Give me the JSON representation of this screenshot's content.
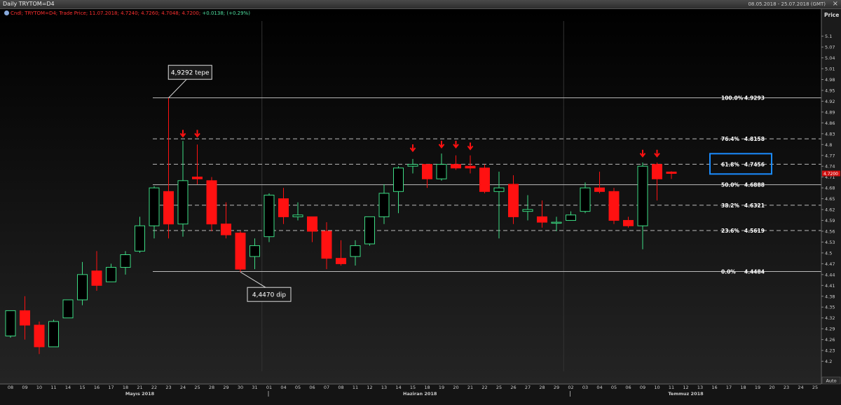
{
  "window": {
    "title": "Daily TRYTOM=D4",
    "date_range": "08.05.2018 - 25.07.2018 (GMT)",
    "close_glyph": "×"
  },
  "legend": {
    "icon": "series-dot-icon",
    "series_text": "Cndl; TRYTOM=D4; Trade Price; 11.07.2018; 4.7240; 4.7260; 4.7048; 4.7200;",
    "change_text": "+0.0138; (+0.29%)"
  },
  "colors": {
    "up": "#3ddc84",
    "down": "#ff1111",
    "arrow": "#ff1111",
    "grid": "#bbbbbb",
    "highlight_box": "#1a8cff",
    "current_price_bg": "#d01010"
  },
  "chart_data": {
    "type": "candlestick",
    "ylabel": "Price",
    "ylim": [
      4.172,
      5.142
    ],
    "y_ticks": [
      "5.1",
      "5.07",
      "5.04",
      "5.01",
      "4.98",
      "4.95",
      "4.92",
      "4.89",
      "4.86",
      "4.83",
      "4.8",
      "4.77",
      "4.74",
      "4.71",
      "4.68",
      "4.65",
      "4.62",
      "4.59",
      "4.56",
      "4.53",
      "4.5",
      "4.47",
      "4.44",
      "4.41",
      "4.38",
      "4.35",
      "4.32",
      "4.29",
      "4.26",
      "4.23",
      "4.2"
    ],
    "current_price_label": "4.7200",
    "x_ticks": [
      "08",
      "09",
      "10",
      "11",
      "14",
      "15",
      "16",
      "17",
      "18",
      "21",
      "22",
      "23",
      "24",
      "25",
      "28",
      "29",
      "30",
      "31",
      "01",
      "04",
      "05",
      "06",
      "07",
      "08",
      "11",
      "12",
      "13",
      "14",
      "15",
      "18",
      "19",
      "20",
      "21",
      "22",
      "25",
      "26",
      "27",
      "28",
      "29",
      "02",
      "03",
      "04",
      "05",
      "06",
      "09",
      "10",
      "11",
      "12",
      "13",
      "16",
      "17",
      "18",
      "19",
      "20",
      "23",
      "24",
      "25"
    ],
    "month_labels": [
      {
        "label": "Mayıs 2018",
        "at": 9
      },
      {
        "label": "Haziran 2018",
        "at": 28.5
      },
      {
        "label": "Temmuz 2018",
        "at": 47
      }
    ],
    "month_separators": [
      18,
      39
    ],
    "auto_label": "Auto",
    "candles": [
      {
        "d": "08",
        "o": 4.27,
        "h": 4.34,
        "l": 4.265,
        "c": 4.34
      },
      {
        "d": "09",
        "o": 4.34,
        "h": 4.38,
        "l": 4.26,
        "c": 4.3
      },
      {
        "d": "10",
        "o": 4.3,
        "h": 4.31,
        "l": 4.22,
        "c": 4.24
      },
      {
        "d": "11",
        "o": 4.24,
        "h": 4.315,
        "l": 4.24,
        "c": 4.31
      },
      {
        "d": "14",
        "o": 4.32,
        "h": 4.37,
        "l": 4.32,
        "c": 4.37
      },
      {
        "d": "15",
        "o": 4.37,
        "h": 4.475,
        "l": 4.355,
        "c": 4.44
      },
      {
        "d": "16",
        "o": 4.45,
        "h": 4.505,
        "l": 4.395,
        "c": 4.41
      },
      {
        "d": "17",
        "o": 4.42,
        "h": 4.47,
        "l": 4.42,
        "c": 4.46
      },
      {
        "d": "18",
        "o": 4.46,
        "h": 4.505,
        "l": 4.44,
        "c": 4.495
      },
      {
        "d": "21",
        "o": 4.505,
        "h": 4.6,
        "l": 4.5,
        "c": 4.575
      },
      {
        "d": "22",
        "o": 4.575,
        "h": 4.685,
        "l": 4.54,
        "c": 4.68
      },
      {
        "d": "23",
        "o": 4.67,
        "h": 4.9292,
        "l": 4.54,
        "c": 4.58
      },
      {
        "d": "24",
        "o": 4.58,
        "h": 4.81,
        "l": 4.545,
        "c": 4.7
      },
      {
        "d": "25",
        "o": 4.71,
        "h": 4.8,
        "l": 4.69,
        "c": 4.705
      },
      {
        "d": "28",
        "o": 4.7,
        "h": 4.71,
        "l": 4.56,
        "c": 4.58
      },
      {
        "d": "29",
        "o": 4.58,
        "h": 4.64,
        "l": 4.54,
        "c": 4.55
      },
      {
        "d": "30",
        "o": 4.555,
        "h": 4.56,
        "l": 4.447,
        "c": 4.455
      },
      {
        "d": "31",
        "o": 4.49,
        "h": 4.54,
        "l": 4.455,
        "c": 4.52
      },
      {
        "d": "01",
        "o": 4.545,
        "h": 4.665,
        "l": 4.53,
        "c": 4.66
      },
      {
        "d": "04",
        "o": 4.65,
        "h": 4.68,
        "l": 4.58,
        "c": 4.6
      },
      {
        "d": "05",
        "o": 4.6,
        "h": 4.64,
        "l": 4.59,
        "c": 4.605
      },
      {
        "d": "06",
        "o": 4.6,
        "h": 4.6,
        "l": 4.53,
        "c": 4.56
      },
      {
        "d": "07",
        "o": 4.56,
        "h": 4.585,
        "l": 4.455,
        "c": 4.485
      },
      {
        "d": "08",
        "o": 4.485,
        "h": 4.535,
        "l": 4.465,
        "c": 4.47
      },
      {
        "d": "11",
        "o": 4.49,
        "h": 4.535,
        "l": 4.465,
        "c": 4.52
      },
      {
        "d": "12",
        "o": 4.525,
        "h": 4.6,
        "l": 4.52,
        "c": 4.6
      },
      {
        "d": "13",
        "o": 4.6,
        "h": 4.69,
        "l": 4.58,
        "c": 4.665
      },
      {
        "d": "14",
        "o": 4.67,
        "h": 4.74,
        "l": 4.61,
        "c": 4.735
      },
      {
        "d": "15",
        "o": 4.74,
        "h": 4.76,
        "l": 4.72,
        "c": 4.745
      },
      {
        "d": "18",
        "o": 4.745,
        "h": 4.745,
        "l": 4.68,
        "c": 4.705
      },
      {
        "d": "19",
        "o": 4.705,
        "h": 4.775,
        "l": 4.7,
        "c": 4.745
      },
      {
        "d": "20",
        "o": 4.745,
        "h": 4.77,
        "l": 4.73,
        "c": 4.735
      },
      {
        "d": "21",
        "o": 4.74,
        "h": 4.77,
        "l": 4.72,
        "c": 4.735
      },
      {
        "d": "22",
        "o": 4.735,
        "h": 4.745,
        "l": 4.665,
        "c": 4.67
      },
      {
        "d": "25",
        "o": 4.67,
        "h": 4.725,
        "l": 4.54,
        "c": 4.68
      },
      {
        "d": "26",
        "o": 4.69,
        "h": 4.715,
        "l": 4.58,
        "c": 4.6
      },
      {
        "d": "27",
        "o": 4.615,
        "h": 4.66,
        "l": 4.59,
        "c": 4.62
      },
      {
        "d": "28",
        "o": 4.6,
        "h": 4.645,
        "l": 4.57,
        "c": 4.585
      },
      {
        "d": "29",
        "o": 4.585,
        "h": 4.6,
        "l": 4.56,
        "c": 4.585
      },
      {
        "d": "02",
        "o": 4.59,
        "h": 4.615,
        "l": 4.59,
        "c": 4.605
      },
      {
        "d": "03",
        "o": 4.615,
        "h": 4.695,
        "l": 4.61,
        "c": 4.68
      },
      {
        "d": "04",
        "o": 4.68,
        "h": 4.725,
        "l": 4.665,
        "c": 4.67
      },
      {
        "d": "05",
        "o": 4.67,
        "h": 4.68,
        "l": 4.58,
        "c": 4.59
      },
      {
        "d": "06",
        "o": 4.59,
        "h": 4.6,
        "l": 4.57,
        "c": 4.575
      },
      {
        "d": "09",
        "o": 4.575,
        "h": 4.75,
        "l": 4.51,
        "c": 4.74
      },
      {
        "d": "10",
        "o": 4.745,
        "h": 4.75,
        "l": 4.645,
        "c": 4.705
      },
      {
        "d": "11",
        "o": 4.724,
        "h": 4.726,
        "l": 4.7048,
        "c": 4.72
      }
    ],
    "fibonacci": [
      {
        "label": "100.0%",
        "value": 4.9293,
        "value_label": "4.9293",
        "dashed": false
      },
      {
        "label": "76.4%",
        "value": 4.8158,
        "value_label": "4.8158",
        "dashed": true
      },
      {
        "label": "61.8%",
        "value": 4.7456,
        "value_label": "4.7456",
        "dashed": true,
        "highlighted": true
      },
      {
        "label": "50.0%",
        "value": 4.6888,
        "value_label": "4.6888",
        "dashed": false
      },
      {
        "label": "38.2%",
        "value": 4.6321,
        "value_label": "4.6321",
        "dashed": true
      },
      {
        "label": "23.6%",
        "value": 4.5619,
        "value_label": "4.5619",
        "dashed": true
      },
      {
        "label": "0.0%",
        "value": 4.4484,
        "value_label": "4.4484",
        "dashed": false
      }
    ],
    "fib_start_index": 10,
    "arrows": [
      {
        "at": 12,
        "price": 4.825
      },
      {
        "at": 13,
        "price": 4.825
      },
      {
        "at": 28,
        "price": 4.785
      },
      {
        "at": 30,
        "price": 4.795
      },
      {
        "at": 31,
        "price": 4.795
      },
      {
        "at": 32,
        "price": 4.79
      },
      {
        "at": 44,
        "price": 4.77
      },
      {
        "at": 45,
        "price": 4.77
      }
    ],
    "annotations": [
      {
        "text": "4,9292 tepe",
        "at": 11,
        "price": 4.9292,
        "label_at": 12.5,
        "label_price": 5.0
      },
      {
        "text": "4,4470  dip",
        "at": 16,
        "price": 4.447,
        "label_at": 18,
        "label_price": 4.385
      }
    ]
  }
}
